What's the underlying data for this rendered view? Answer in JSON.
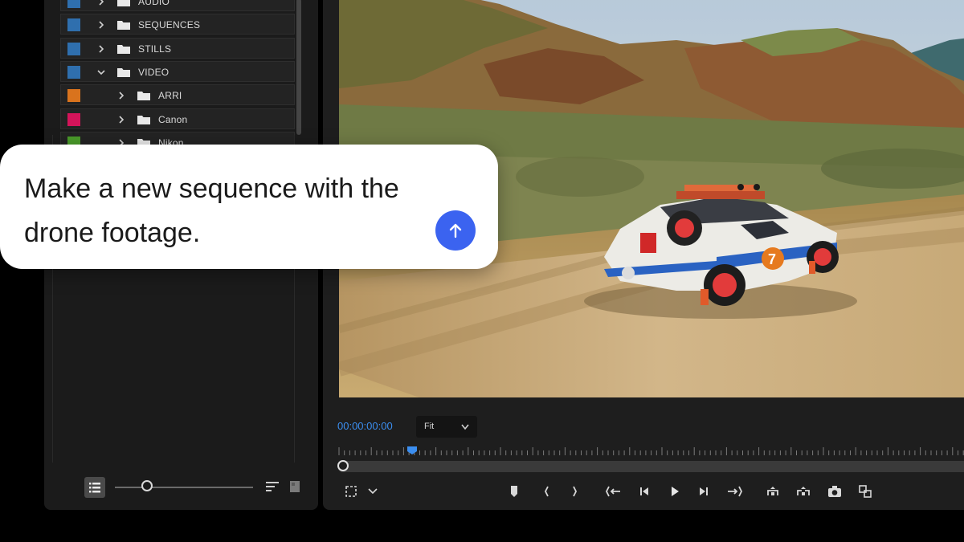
{
  "project_panel": {
    "bins": [
      {
        "label": "AUDIO",
        "color": "#2f6fae",
        "expanded": false
      },
      {
        "label": "SEQUENCES",
        "color": "#2f6fae",
        "expanded": false
      },
      {
        "label": "STILLS",
        "color": "#2f6fae",
        "expanded": false
      },
      {
        "label": "VIDEO",
        "color": "#2f6fae",
        "expanded": true
      },
      {
        "label": "ARRI",
        "color": "#d9731d",
        "expanded": false
      },
      {
        "label": "Canon",
        "color": "#d4145a",
        "expanded": false
      },
      {
        "label": "Nikon",
        "color": "#4a9b2a",
        "expanded": false
      }
    ],
    "zoom_level": 0.24
  },
  "program_monitor": {
    "timecode": "00:00:00:00",
    "fit_value": "Fit",
    "playhead_position": 0.12,
    "accent_color": "#3b8ef0"
  },
  "chat": {
    "message": "Make a new sequence with the drone footage.",
    "send_color": "#3b63f0"
  },
  "icons": {
    "list_view": "list-view-icon",
    "sort": "sort-icon",
    "freeform": "freeform-view-icon",
    "send": "arrow-up-icon"
  }
}
